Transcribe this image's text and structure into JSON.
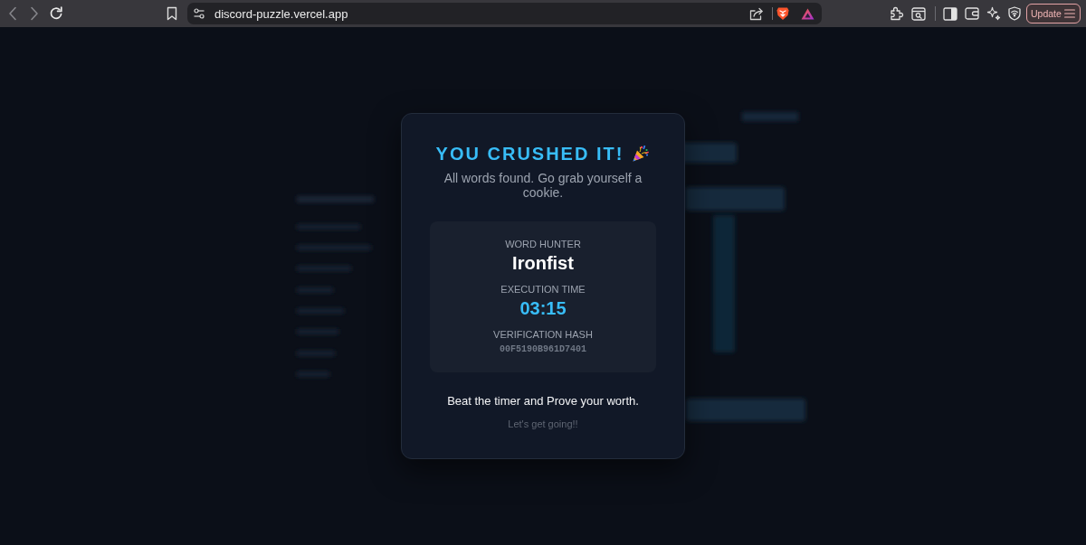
{
  "browser": {
    "back": {
      "disabled": true
    },
    "forward": {
      "disabled": true
    },
    "url": "discord-puzzle.vercel.app",
    "update_button": "Update"
  },
  "modal": {
    "title": "YOU CRUSHED IT!",
    "subtitle": "All words found. Go grab yourself a cookie.",
    "stats": [
      {
        "kind": "name",
        "label": "WORD HUNTER",
        "value": "Ironfist"
      },
      {
        "kind": "time",
        "label": "EXECUTION TIME",
        "value": "03:15"
      },
      {
        "kind": "hash",
        "label": "VERIFICATION HASH",
        "value": "00F5190B961D7401"
      }
    ],
    "tagline": "Beat the timer and Prove your worth.",
    "footnote": "Let's get going!!"
  }
}
